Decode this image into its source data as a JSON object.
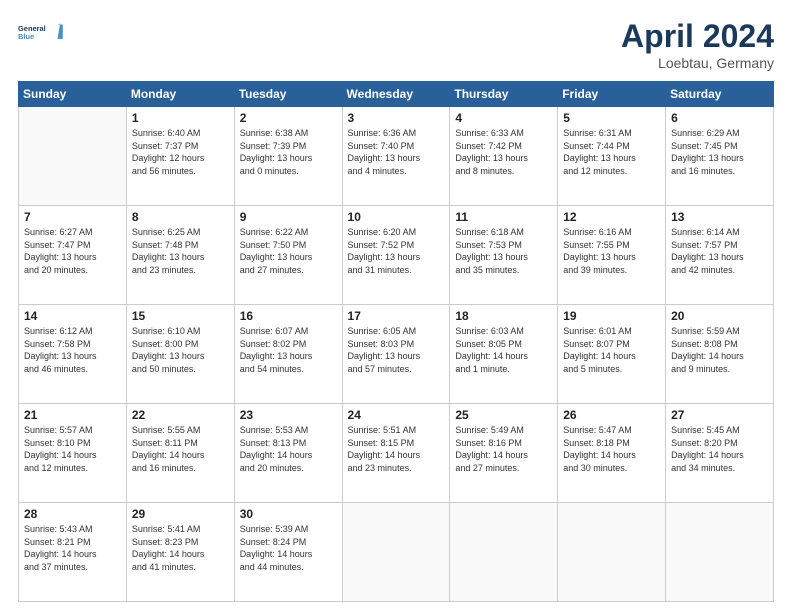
{
  "header": {
    "logo_line1": "General",
    "logo_line2": "Blue",
    "month": "April 2024",
    "location": "Loebtau, Germany"
  },
  "days_of_week": [
    "Sunday",
    "Monday",
    "Tuesday",
    "Wednesday",
    "Thursday",
    "Friday",
    "Saturday"
  ],
  "weeks": [
    [
      {
        "day": "",
        "info": ""
      },
      {
        "day": "1",
        "info": "Sunrise: 6:40 AM\nSunset: 7:37 PM\nDaylight: 12 hours\nand 56 minutes."
      },
      {
        "day": "2",
        "info": "Sunrise: 6:38 AM\nSunset: 7:39 PM\nDaylight: 13 hours\nand 0 minutes."
      },
      {
        "day": "3",
        "info": "Sunrise: 6:36 AM\nSunset: 7:40 PM\nDaylight: 13 hours\nand 4 minutes."
      },
      {
        "day": "4",
        "info": "Sunrise: 6:33 AM\nSunset: 7:42 PM\nDaylight: 13 hours\nand 8 minutes."
      },
      {
        "day": "5",
        "info": "Sunrise: 6:31 AM\nSunset: 7:44 PM\nDaylight: 13 hours\nand 12 minutes."
      },
      {
        "day": "6",
        "info": "Sunrise: 6:29 AM\nSunset: 7:45 PM\nDaylight: 13 hours\nand 16 minutes."
      }
    ],
    [
      {
        "day": "7",
        "info": "Sunrise: 6:27 AM\nSunset: 7:47 PM\nDaylight: 13 hours\nand 20 minutes."
      },
      {
        "day": "8",
        "info": "Sunrise: 6:25 AM\nSunset: 7:48 PM\nDaylight: 13 hours\nand 23 minutes."
      },
      {
        "day": "9",
        "info": "Sunrise: 6:22 AM\nSunset: 7:50 PM\nDaylight: 13 hours\nand 27 minutes."
      },
      {
        "day": "10",
        "info": "Sunrise: 6:20 AM\nSunset: 7:52 PM\nDaylight: 13 hours\nand 31 minutes."
      },
      {
        "day": "11",
        "info": "Sunrise: 6:18 AM\nSunset: 7:53 PM\nDaylight: 13 hours\nand 35 minutes."
      },
      {
        "day": "12",
        "info": "Sunrise: 6:16 AM\nSunset: 7:55 PM\nDaylight: 13 hours\nand 39 minutes."
      },
      {
        "day": "13",
        "info": "Sunrise: 6:14 AM\nSunset: 7:57 PM\nDaylight: 13 hours\nand 42 minutes."
      }
    ],
    [
      {
        "day": "14",
        "info": "Sunrise: 6:12 AM\nSunset: 7:58 PM\nDaylight: 13 hours\nand 46 minutes."
      },
      {
        "day": "15",
        "info": "Sunrise: 6:10 AM\nSunset: 8:00 PM\nDaylight: 13 hours\nand 50 minutes."
      },
      {
        "day": "16",
        "info": "Sunrise: 6:07 AM\nSunset: 8:02 PM\nDaylight: 13 hours\nand 54 minutes."
      },
      {
        "day": "17",
        "info": "Sunrise: 6:05 AM\nSunset: 8:03 PM\nDaylight: 13 hours\nand 57 minutes."
      },
      {
        "day": "18",
        "info": "Sunrise: 6:03 AM\nSunset: 8:05 PM\nDaylight: 14 hours\nand 1 minute."
      },
      {
        "day": "19",
        "info": "Sunrise: 6:01 AM\nSunset: 8:07 PM\nDaylight: 14 hours\nand 5 minutes."
      },
      {
        "day": "20",
        "info": "Sunrise: 5:59 AM\nSunset: 8:08 PM\nDaylight: 14 hours\nand 9 minutes."
      }
    ],
    [
      {
        "day": "21",
        "info": "Sunrise: 5:57 AM\nSunset: 8:10 PM\nDaylight: 14 hours\nand 12 minutes."
      },
      {
        "day": "22",
        "info": "Sunrise: 5:55 AM\nSunset: 8:11 PM\nDaylight: 14 hours\nand 16 minutes."
      },
      {
        "day": "23",
        "info": "Sunrise: 5:53 AM\nSunset: 8:13 PM\nDaylight: 14 hours\nand 20 minutes."
      },
      {
        "day": "24",
        "info": "Sunrise: 5:51 AM\nSunset: 8:15 PM\nDaylight: 14 hours\nand 23 minutes."
      },
      {
        "day": "25",
        "info": "Sunrise: 5:49 AM\nSunset: 8:16 PM\nDaylight: 14 hours\nand 27 minutes."
      },
      {
        "day": "26",
        "info": "Sunrise: 5:47 AM\nSunset: 8:18 PM\nDaylight: 14 hours\nand 30 minutes."
      },
      {
        "day": "27",
        "info": "Sunrise: 5:45 AM\nSunset: 8:20 PM\nDaylight: 14 hours\nand 34 minutes."
      }
    ],
    [
      {
        "day": "28",
        "info": "Sunrise: 5:43 AM\nSunset: 8:21 PM\nDaylight: 14 hours\nand 37 minutes."
      },
      {
        "day": "29",
        "info": "Sunrise: 5:41 AM\nSunset: 8:23 PM\nDaylight: 14 hours\nand 41 minutes."
      },
      {
        "day": "30",
        "info": "Sunrise: 5:39 AM\nSunset: 8:24 PM\nDaylight: 14 hours\nand 44 minutes."
      },
      {
        "day": "",
        "info": ""
      },
      {
        "day": "",
        "info": ""
      },
      {
        "day": "",
        "info": ""
      },
      {
        "day": "",
        "info": ""
      }
    ]
  ]
}
